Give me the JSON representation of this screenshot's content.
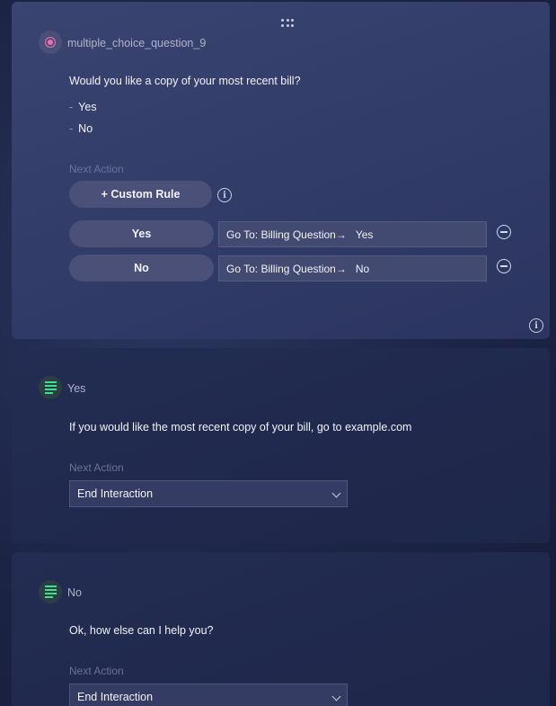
{
  "question_node": {
    "title": "multiple_choice_question_9",
    "prompt": "Would you like a copy of your most recent bill?",
    "options": [
      "Yes",
      "No"
    ],
    "option_bullet": "-",
    "next_action_label": "Next Action",
    "custom_rule_label": "+ Custom Rule",
    "info_glyph": "i",
    "rules": [
      {
        "answer": "Yes",
        "target": "Go To: Billing Question→",
        "target_value": "Yes"
      },
      {
        "answer": "No",
        "target": "Go To: Billing Question→",
        "target_value": "No"
      }
    ]
  },
  "yes_node": {
    "title": "Yes",
    "message": "If you would like the most recent copy of your bill, go to example.com",
    "next_action_label": "Next Action",
    "next_action_value": "End Interaction"
  },
  "no_node": {
    "title": "No",
    "message": "Ok, how else can I help you?",
    "next_action_label": "Next Action",
    "next_action_value": "End Interaction"
  },
  "colors": {
    "accent_pink": "#ee6fb4",
    "accent_green": "#3fe08c",
    "background": "#1c2446"
  },
  "icons": [
    "drag-handle-icon",
    "radio-question-icon",
    "info-icon",
    "remove-icon",
    "text-message-icon",
    "chevron-down-icon"
  ]
}
